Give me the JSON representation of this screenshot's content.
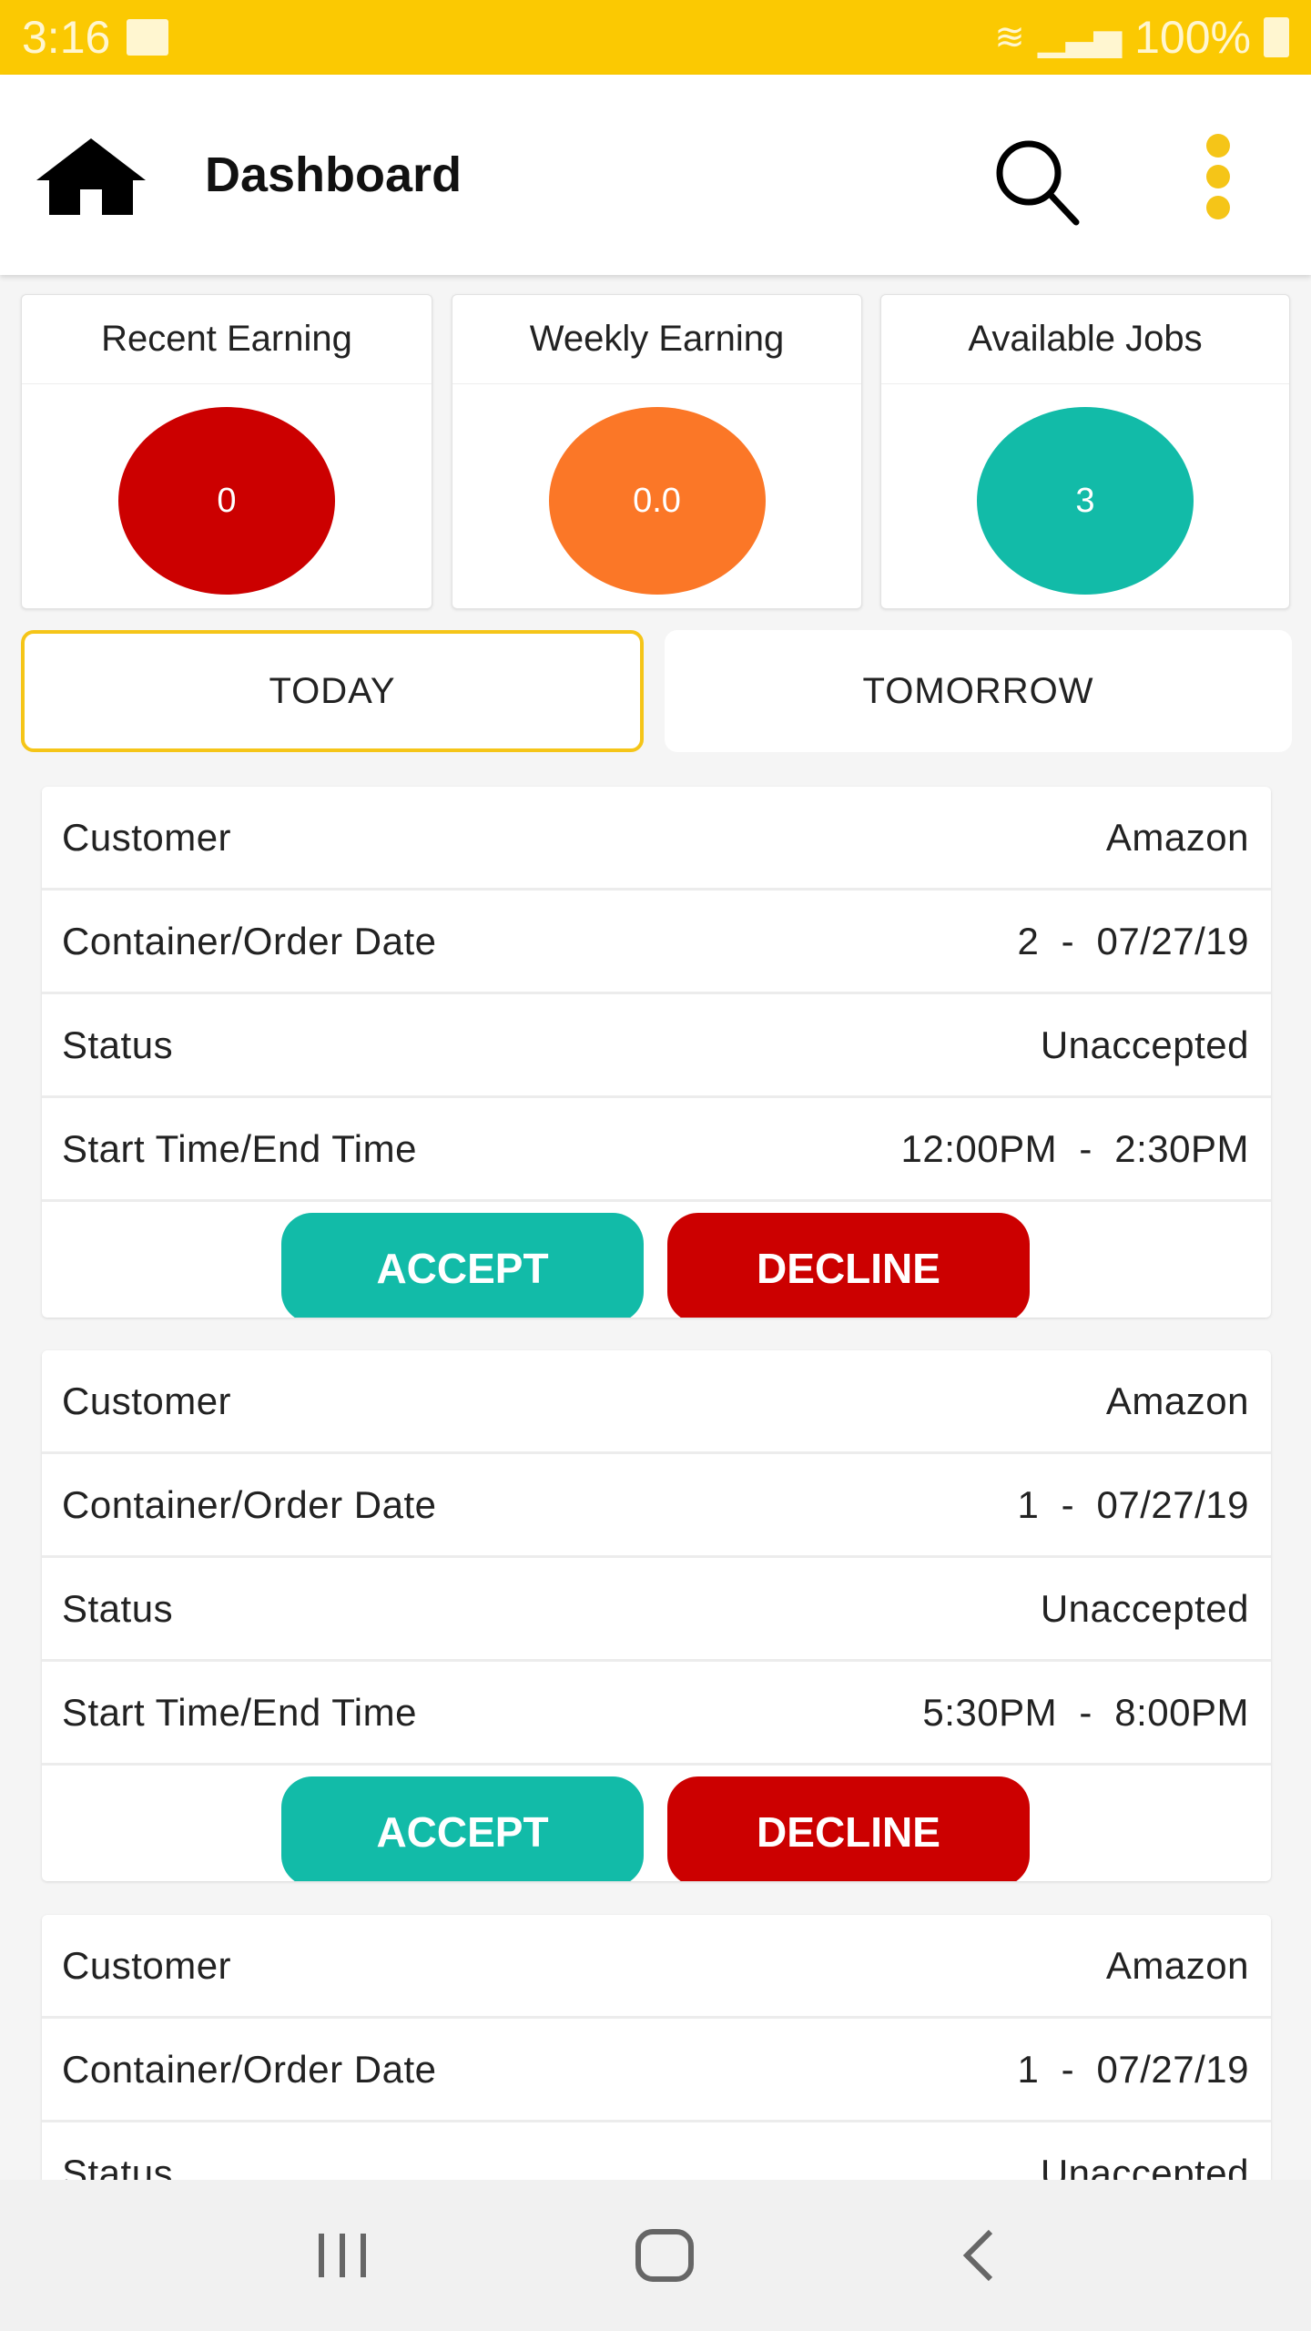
{
  "status_bar": {
    "time": "3:16",
    "battery": "100%"
  },
  "header": {
    "title": "Dashboard"
  },
  "stats": [
    {
      "label": "Recent Earning",
      "value": "0",
      "color": "#cc0000"
    },
    {
      "label": "Weekly Earning",
      "value": "0.0",
      "color": "#fb7727"
    },
    {
      "label": "Available Jobs",
      "value": "3",
      "color": "#12bba8"
    }
  ],
  "tabs": [
    {
      "label": "TODAY",
      "active": true
    },
    {
      "label": "TOMORROW",
      "active": false
    }
  ],
  "jobs": [
    {
      "rows": [
        {
          "label": "Customer",
          "value": "Amazon"
        },
        {
          "label": "Container/Order Date",
          "value": "2  -  07/27/19"
        },
        {
          "label": "Status",
          "value": "Unaccepted"
        },
        {
          "label": "Start Time/End Time",
          "value": "12:00PM  -  2:30PM"
        }
      ],
      "accept": "ACCEPT",
      "decline": "DECLINE"
    },
    {
      "rows": [
        {
          "label": "Customer",
          "value": "Amazon"
        },
        {
          "label": "Container/Order Date",
          "value": "1  -  07/27/19"
        },
        {
          "label": "Status",
          "value": "Unaccepted"
        },
        {
          "label": "Start Time/End Time",
          "value": "5:30PM  -  8:00PM"
        }
      ],
      "accept": "ACCEPT",
      "decline": "DECLINE"
    },
    {
      "rows": [
        {
          "label": "Customer",
          "value": "Amazon"
        },
        {
          "label": "Container/Order Date",
          "value": "1  -  07/27/19"
        },
        {
          "label": "Status",
          "value": "Unaccepted"
        }
      ]
    }
  ],
  "colors": {
    "accent": "#fbc902",
    "accept": "#12bba8",
    "decline": "#cc0000"
  }
}
